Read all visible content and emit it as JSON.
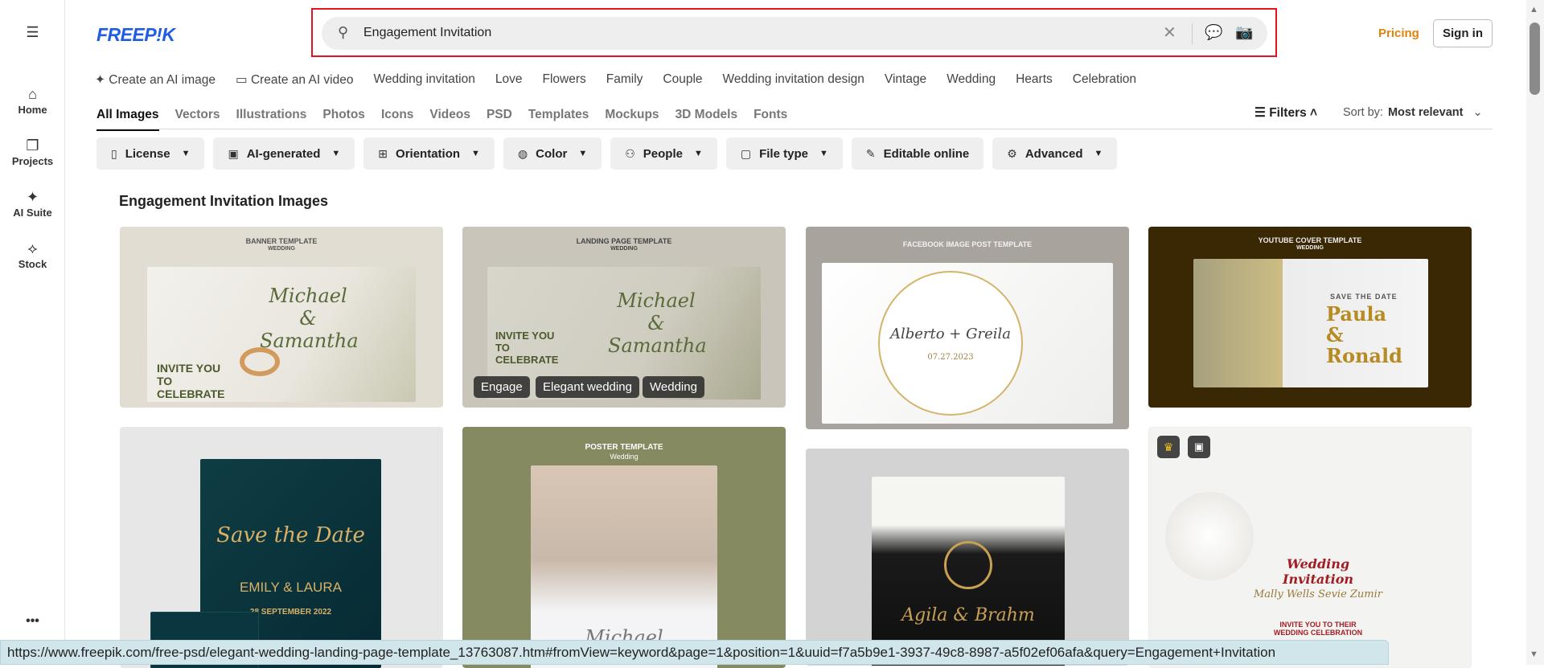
{
  "sidebar": {
    "items": [
      {
        "label": "Home",
        "icon": "home-icon"
      },
      {
        "label": "Projects",
        "icon": "projects-icon"
      },
      {
        "label": "AI Suite",
        "icon": "ai-suite-icon"
      },
      {
        "label": "Stock",
        "icon": "stock-icon"
      }
    ],
    "more": "•••"
  },
  "header": {
    "logo": "FREEP!K",
    "search_value": "Engagement Invitation",
    "pricing": "Pricing",
    "sign_in": "Sign in"
  },
  "suggestions": [
    "Create an AI image",
    "Create an AI video",
    "Wedding invitation",
    "Love",
    "Flowers",
    "Family",
    "Couple",
    "Wedding invitation design",
    "Vintage",
    "Wedding",
    "Hearts",
    "Celebration"
  ],
  "tabs": [
    "All Images",
    "Vectors",
    "Illustrations",
    "Photos",
    "Icons",
    "Videos",
    "PSD",
    "Templates",
    "Mockups",
    "3D Models",
    "Fonts"
  ],
  "filters_label": "Filters",
  "sort": {
    "label": "Sort by:",
    "value": "Most relevant"
  },
  "chips": [
    "License",
    "AI-generated",
    "Orientation",
    "Color",
    "People",
    "File type",
    "Editable online",
    "Advanced"
  ],
  "heading": "Engagement Invitation Images",
  "tiles": [
    {
      "title": "BANNER TEMPLATE",
      "sub": "WEDDING",
      "names": "Michael & Samantha",
      "cta": "INVITE YOU TO CELEBRATE"
    },
    {
      "title": "LANDING PAGE TEMPLATE",
      "sub": "WEDDING",
      "names": "Michael & Samantha",
      "cta": "INVITE YOU TO CELEBRATE",
      "tags": [
        "Engage",
        "Elegant wedding",
        "Wedding"
      ]
    },
    {
      "title": "FACEBOOK IMAGE POST TEMPLATE",
      "names": "Alberto + Greila",
      "date": "07.27.2023"
    },
    {
      "title": "YOUTUBE COVER TEMPLATE",
      "sub": "WEDDING",
      "save": "SAVE THE DATE",
      "names": "Paula & Ronald"
    },
    {
      "script": "Save the Date",
      "names": "EMILY & LAURA",
      "date": "28 SEPTEMBER 2022"
    },
    {
      "title": "POSTER TEMPLATE",
      "sub": "Wedding",
      "names": "Michael"
    },
    {
      "names": "Agila & Brahm"
    },
    {
      "title": "Wedding Invitation",
      "names": "Mally Wells  Sevie Zumir",
      "cta": "INVITE YOU TO THEIR WEDDING CELEBRATION"
    }
  ],
  "status_url": "https://www.freepik.com/free-psd/elegant-wedding-landing-page-template_13763087.htm#fromView=keyword&page=1&position=1&uuid=f7a5b9e1-3937-49c8-8987-a5f02ef06afa&query=Engagement+Invitation"
}
